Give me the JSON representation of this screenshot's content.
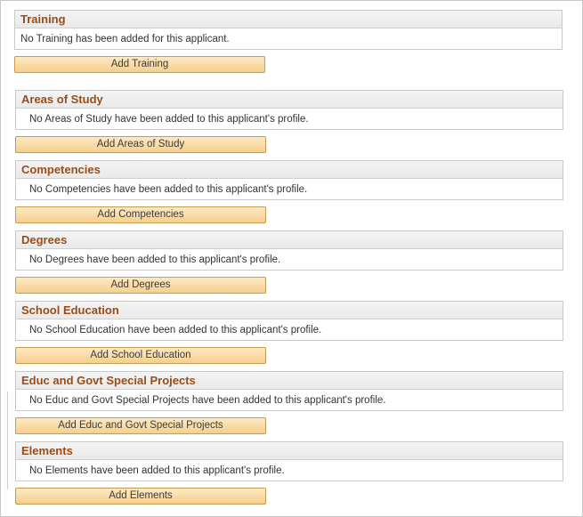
{
  "sections": [
    {
      "title": "Training",
      "message": "No Training has been added for this applicant.",
      "button": "Add Training"
    },
    {
      "title": "Areas of Study",
      "message": "No Areas of Study have been added to this applicant's profile.",
      "button": "Add Areas of Study"
    },
    {
      "title": "Competencies",
      "message": "No Competencies have been added to this applicant's profile.",
      "button": "Add Competencies"
    },
    {
      "title": "Degrees",
      "message": "No Degrees have been added to this applicant's profile.",
      "button": "Add Degrees"
    },
    {
      "title": "School Education",
      "message": "No School Education have been added to this applicant's profile.",
      "button": "Add School Education"
    },
    {
      "title": "Educ and Govt Special Projects",
      "message": "No Educ and Govt Special Projects have been added to this applicant's profile.",
      "button": "Add Educ and Govt Special Projects"
    },
    {
      "title": "Elements",
      "message": "No Elements have been added to this applicant's profile.",
      "button": "Add Elements"
    }
  ],
  "colors": {
    "header_text": "#9a4d16",
    "button_fill": "#f6cf8c",
    "button_border": "#c69b52"
  }
}
